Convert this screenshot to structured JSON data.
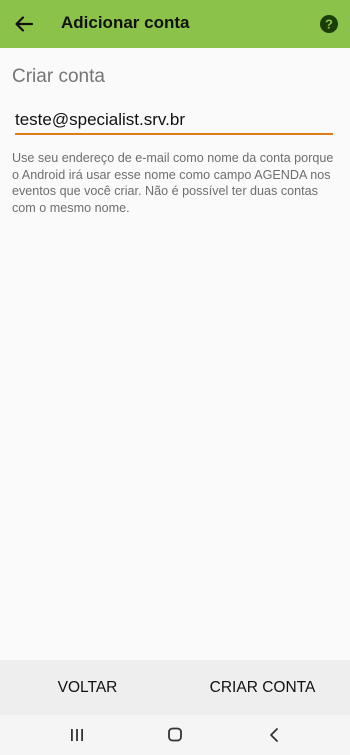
{
  "appbar": {
    "title": "Adicionar conta",
    "back_icon": "arrow-back-icon",
    "help_icon": "help-icon",
    "background": "#8bc34a"
  },
  "form": {
    "section_title": "Criar conta",
    "account_name_value": "teste@specialist.srv.br",
    "accent_color": "#e07b18",
    "help_text": "Use seu endereço de e-mail como nome da conta porque o Android irá usar esse nome como campo AGENDA nos eventos que você criar. Não é possível ter duas contas com o mesmo nome."
  },
  "buttons": {
    "back_label": "VOLTAR",
    "create_label": "CRIAR CONTA"
  },
  "navbar": {
    "recents_icon": "recents-icon",
    "home_icon": "home-icon",
    "back_icon": "nav-back-icon"
  }
}
